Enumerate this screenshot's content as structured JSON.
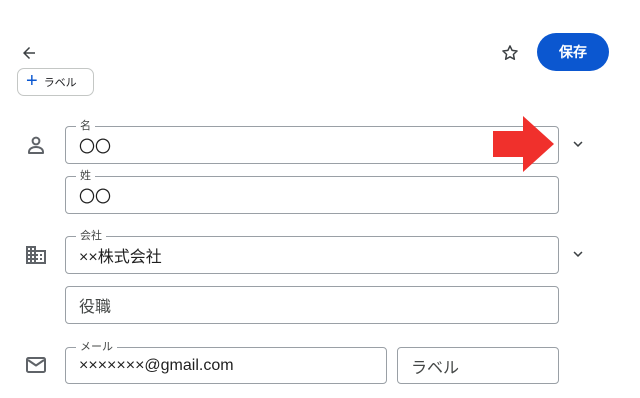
{
  "toolbar": {
    "save_label": "保存",
    "add_label_text": "ラベル"
  },
  "form": {
    "first_name": {
      "label": "名",
      "value": "〇〇"
    },
    "last_name": {
      "label": "姓",
      "value": "〇〇"
    },
    "company": {
      "label": "会社",
      "value": "××株式会社"
    },
    "job_title": {
      "placeholder": "役職"
    },
    "email": {
      "label": "メール",
      "value": "×××××××@gmail.com"
    },
    "email_label": {
      "placeholder": "ラベル"
    }
  },
  "icons": {
    "back": "arrow-left-icon",
    "star": "star-outline-icon",
    "person": "person-icon",
    "company": "building-icon",
    "email": "mail-icon",
    "expand": "chevron-down-icon",
    "annotation": "red-arrow-annotation"
  },
  "colors": {
    "accent": "#0b57d0",
    "annotation_red": "#f0302c",
    "border": "#9aa0a6",
    "icon": "#5f6368"
  }
}
